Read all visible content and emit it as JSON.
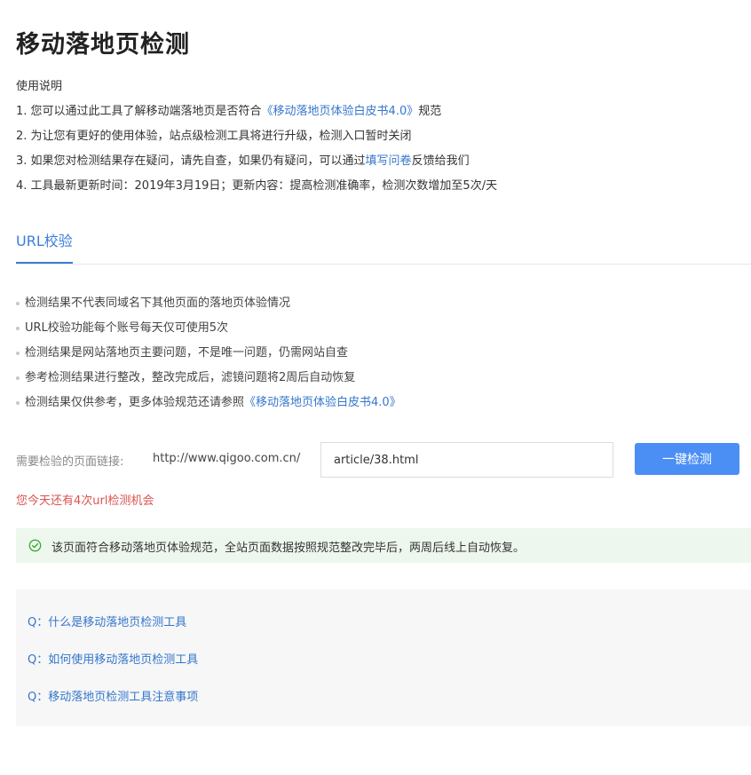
{
  "page": {
    "title": "移动落地页检测"
  },
  "usage": {
    "heading": "使用说明",
    "line1_prefix": "1. 您可以通过此工具了解移动端落地页是否符合",
    "line1_link": "《移动落地页体验白皮书4.0》",
    "line1_suffix": "规范",
    "line2": "2. 为让您有更好的使用体验，站点级检测工具将进行升级，检测入口暂时关闭",
    "line3_prefix": "3. 如果您对检测结果存在疑问，请先自查，如果仍有疑问，可以通过",
    "line3_link": "填写问卷",
    "line3_suffix": "反馈给我们",
    "line4": "4. 工具最新更新时间：2019年3月19日；更新内容：提高检测准确率，检测次数增加至5次/天"
  },
  "tabs": {
    "active_label": "URL校验"
  },
  "notes": {
    "item1": "检测结果不代表同域名下其他页面的落地页体验情况",
    "item2": "URL校验功能每个账号每天仅可使用5次",
    "item3": "检测结果是网站落地页主要问题，不是唯一问题，仍需网站自查",
    "item4": "参考检测结果进行整改，整改完成后，滤镜问题将2周后自动恢复",
    "item5_prefix": "检测结果仅供参考，更多体验规范还请参照",
    "item5_link": "《移动落地页体验白皮书4.0》"
  },
  "form": {
    "label": "需要检验的页面链接:",
    "url_prefix": "http://www.qigoo.com.cn/",
    "url_value": "article/38.html",
    "submit_label": "一键检测",
    "remaining_text": "您今天还有4次url检测机会"
  },
  "result": {
    "icon": "check-circle-icon",
    "message": "该页面符合移动落地页体验规范，全站页面数据按照规范整改完毕后，两周后线上自动恢复。"
  },
  "faq": {
    "q1": "Q：什么是移动落地页检测工具",
    "q2": "Q：如何使用移动落地页检测工具",
    "q3": "Q：移动落地页检测工具注意事项"
  },
  "colors": {
    "accent": "#3b7dd8",
    "link": "#3476cc",
    "button": "#4b8ff5",
    "warning": "#d9534f",
    "success_bg": "#eef7ee",
    "success_icon": "#3aaa35",
    "faq_bg": "#f7f7f7"
  }
}
